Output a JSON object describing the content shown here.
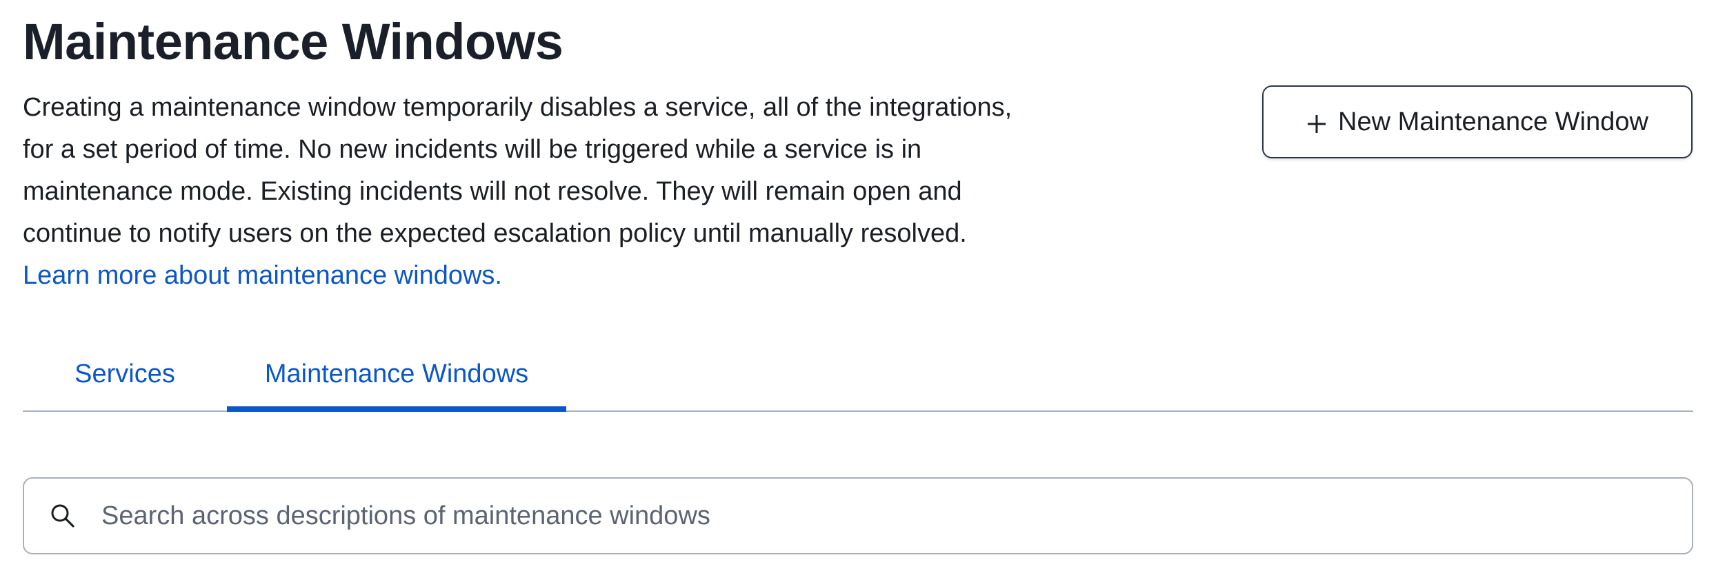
{
  "header": {
    "title": "Maintenance Windows",
    "description": "Creating a maintenance window temporarily disables a service, all of the integrations, for a set period of time. No new incidents will be triggered while a service is in maintenance mode. Existing incidents will not resolve. They will remain open and continue to notify users on the expected escalation policy until manually resolved.",
    "learn_more_link": "Learn more about maintenance windows.",
    "new_button_label": "New Maintenance Window",
    "new_button_icon": "plus-icon"
  },
  "tabs": [
    {
      "label": "Services",
      "selected": false
    },
    {
      "label": "Maintenance Windows",
      "selected": true
    }
  ],
  "search": {
    "icon": "search-icon",
    "value": "",
    "placeholder": "Search across descriptions of maintenance windows"
  },
  "colors": {
    "accent": "#0b57c7",
    "text": "#1b1f24",
    "border": "#a8b0bc"
  }
}
